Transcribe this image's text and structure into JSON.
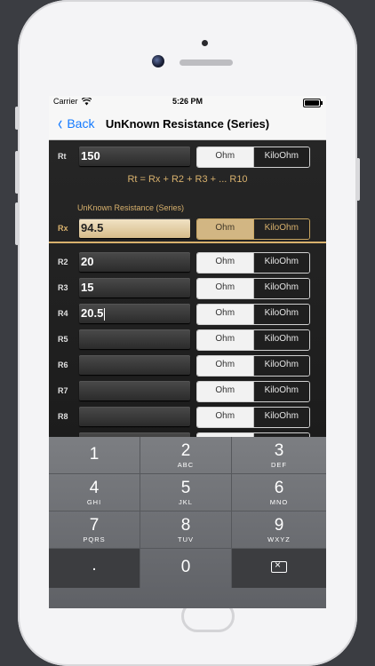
{
  "status": {
    "carrier": "Carrier",
    "time": "5:26 PM"
  },
  "nav": {
    "back_label": "Back",
    "title": "UnKnown Resistance (Series)"
  },
  "rt": {
    "label": "Rt",
    "value": "150"
  },
  "formula": "Rt = Rx + R2 + R3 + ... R10",
  "unknown_title": "UnKnown Resistance (Series)",
  "rx": {
    "label": "Rx",
    "value": "94.5"
  },
  "units": {
    "ohm": "Ohm",
    "kiloohm": "KiloOhm"
  },
  "resistors": [
    {
      "label": "R2",
      "value": "20"
    },
    {
      "label": "R3",
      "value": "15"
    },
    {
      "label": "R4",
      "value": "20.5"
    },
    {
      "label": "R5",
      "value": ""
    },
    {
      "label": "R6",
      "value": ""
    },
    {
      "label": "R7",
      "value": ""
    },
    {
      "label": "R8",
      "value": ""
    }
  ],
  "keypad": [
    {
      "digit": "1",
      "letters": ""
    },
    {
      "digit": "2",
      "letters": "ABC"
    },
    {
      "digit": "3",
      "letters": "DEF"
    },
    {
      "digit": "4",
      "letters": "GHI"
    },
    {
      "digit": "5",
      "letters": "JKL"
    },
    {
      "digit": "6",
      "letters": "MNO"
    },
    {
      "digit": "7",
      "letters": "PQRS"
    },
    {
      "digit": "8",
      "letters": "TUV"
    },
    {
      "digit": "9",
      "letters": "WXYZ"
    },
    {
      "digit": ".",
      "letters": ""
    },
    {
      "digit": "0",
      "letters": ""
    }
  ],
  "colors": {
    "accent": "#1279ff",
    "gold": "#d8b16d"
  }
}
